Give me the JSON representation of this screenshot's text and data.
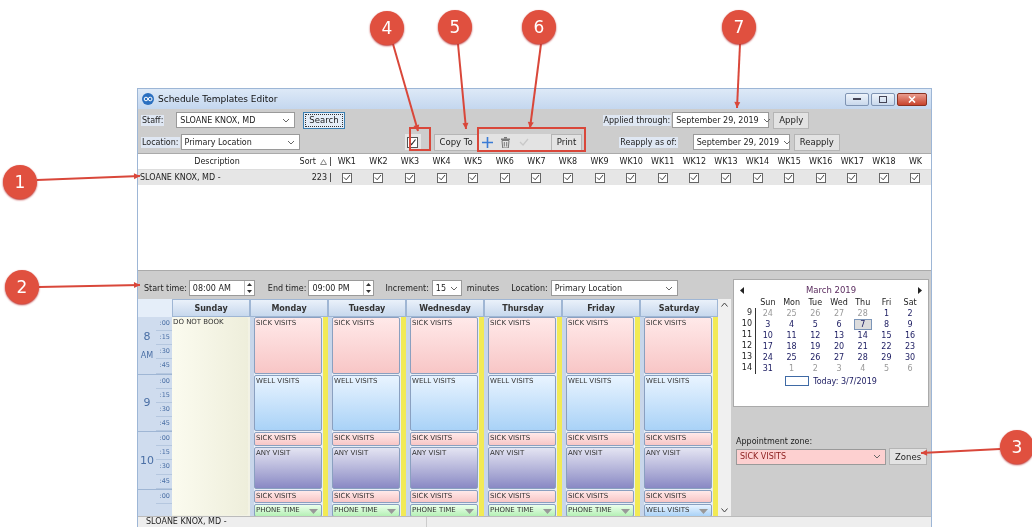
{
  "window": {
    "title": "Schedule Templates Editor"
  },
  "toolbar": {
    "staff_label": "Staff:",
    "staff": "SLOANE KNOX, MD",
    "search_button": "Search",
    "location_label": "Location:",
    "location": "Primary Location",
    "checkbox_checked": true,
    "copy_to_button": "Copy To",
    "tools": [
      {
        "kind": "add",
        "disabled": false
      },
      {
        "kind": "delete",
        "disabled": false
      },
      {
        "kind": "confirm",
        "disabled": true
      }
    ],
    "print_button": "Print",
    "applied_label": "Applied through:",
    "applied_date": "September 29, 2019",
    "apply_button": "Apply",
    "reapply_label": "Reapply as of:",
    "reapply_date": "September 29, 2019",
    "reapply_button": "Reapply"
  },
  "template_table": {
    "columns": [
      "Description",
      "Sort",
      "WK1",
      "WK2",
      "WK3",
      "WK4",
      "WK5",
      "WK6",
      "WK7",
      "WK8",
      "WK9",
      "WK10",
      "WK11",
      "WK12",
      "WK13",
      "WK14",
      "WK15",
      "WK16",
      "WK17",
      "WK18",
      "WK"
    ],
    "rows": [
      {
        "description": "SLOANE KNOX, MD -",
        "sort": "223",
        "selected": true,
        "weeks": [
          true,
          true,
          true,
          true,
          true,
          true,
          true,
          true,
          true,
          true,
          true,
          true,
          true,
          true,
          true,
          true,
          true,
          true,
          true
        ]
      }
    ]
  },
  "time_settings": {
    "start_label": "Start time:",
    "start": "08:00 AM",
    "end_label": "End time:",
    "end": "09:00 PM",
    "increment_label": "Increment:",
    "increment": "15",
    "unit": "minutes",
    "location_label": "Location:",
    "location": "Primary Location"
  },
  "schedule": {
    "hours": [
      {
        "hour": "8",
        "period": "AM",
        "minutes": [
          ":00",
          ":15",
          ":30",
          ":45"
        ]
      },
      {
        "hour": "9",
        "minutes": [
          ":00",
          ":15",
          ":30",
          ":45"
        ]
      },
      {
        "hour": "10",
        "minutes": [
          ":00",
          ":15",
          ":30",
          ":45"
        ]
      },
      {
        "minutes": [
          ":00"
        ]
      }
    ],
    "days": [
      {
        "name": "Sunday",
        "slots": [
          {
            "label": "DO NOT BOOK",
            "kind": "blocked"
          },
          {
            "continues": true
          },
          {
            "continues": true
          },
          {
            "continues": true
          },
          {
            "continues": true
          },
          {
            "continues": true
          },
          {
            "continues": true
          },
          {
            "continues": true
          },
          {
            "continues": true
          },
          {
            "continues": true
          },
          {
            "continues": true
          },
          {
            "continues": true
          },
          {
            "continues": true
          },
          {
            "continues": true
          }
        ]
      },
      {
        "name": "Monday",
        "slots": [
          {
            "label": "SICK VISITS",
            "kind": "sick"
          },
          {
            "continues": true
          },
          {
            "continues": true
          },
          {
            "continues": true
          },
          {
            "label": "WELL VISITS",
            "kind": "well"
          },
          {
            "continues": true
          },
          {
            "continues": true
          },
          {
            "continues": true
          },
          {
            "label": "SICK VISITS",
            "kind": "sick"
          },
          {
            "label": "ANY VISIT",
            "kind": "any"
          },
          {
            "continues": true
          },
          {
            "continues": true
          },
          {
            "label": "SICK VISITS",
            "kind": "sick"
          },
          {
            "label": "PHONE TIME",
            "kind": "phone",
            "dropdown": true
          }
        ]
      },
      {
        "name": "Tuesday",
        "slots": [
          {
            "label": "SICK VISITS",
            "kind": "sick"
          },
          {
            "continues": true
          },
          {
            "continues": true
          },
          {
            "continues": true
          },
          {
            "label": "WELL VISITS",
            "kind": "well"
          },
          {
            "continues": true
          },
          {
            "continues": true
          },
          {
            "continues": true
          },
          {
            "label": "SICK VISITS",
            "kind": "sick"
          },
          {
            "label": "ANY VISIT",
            "kind": "any"
          },
          {
            "continues": true
          },
          {
            "continues": true
          },
          {
            "label": "SICK VISITS",
            "kind": "sick"
          },
          {
            "label": "PHONE TIME",
            "kind": "phone",
            "dropdown": true
          }
        ]
      },
      {
        "name": "Wednesday",
        "slots": [
          {
            "label": "SICK VISITS",
            "kind": "sick"
          },
          {
            "continues": true
          },
          {
            "continues": true
          },
          {
            "continues": true
          },
          {
            "label": "WELL VISITS",
            "kind": "well"
          },
          {
            "continues": true
          },
          {
            "continues": true
          },
          {
            "continues": true
          },
          {
            "label": "SICK VISITS",
            "kind": "sick"
          },
          {
            "label": "ANY VISIT",
            "kind": "any"
          },
          {
            "continues": true
          },
          {
            "continues": true
          },
          {
            "label": "SICK VISITS",
            "kind": "sick"
          },
          {
            "label": "PHONE TIME",
            "kind": "phone",
            "dropdown": true
          }
        ]
      },
      {
        "name": "Thursday",
        "slots": [
          {
            "label": "SICK VISITS",
            "kind": "sick"
          },
          {
            "continues": true
          },
          {
            "continues": true
          },
          {
            "continues": true
          },
          {
            "label": "WELL VISITS",
            "kind": "well"
          },
          {
            "continues": true
          },
          {
            "continues": true
          },
          {
            "continues": true
          },
          {
            "label": "SICK VISITS",
            "kind": "sick"
          },
          {
            "label": "ANY VISIT",
            "kind": "any"
          },
          {
            "continues": true
          },
          {
            "continues": true
          },
          {
            "label": "SICK VISITS",
            "kind": "sick"
          },
          {
            "label": "PHONE TIME",
            "kind": "phone",
            "dropdown": true
          }
        ]
      },
      {
        "name": "Friday",
        "slots": [
          {
            "label": "SICK VISITS",
            "kind": "sick"
          },
          {
            "continues": true
          },
          {
            "continues": true
          },
          {
            "continues": true
          },
          {
            "label": "WELL VISITS",
            "kind": "well"
          },
          {
            "continues": true
          },
          {
            "continues": true
          },
          {
            "continues": true
          },
          {
            "label": "SICK VISITS",
            "kind": "sick"
          },
          {
            "label": "ANY VISIT",
            "kind": "any"
          },
          {
            "continues": true
          },
          {
            "continues": true
          },
          {
            "label": "SICK VISITS",
            "kind": "sick"
          },
          {
            "label": "PHONE TIME",
            "kind": "phone",
            "dropdown": true
          }
        ]
      },
      {
        "name": "Saturday",
        "slots": [
          {
            "label": "SICK VISITS",
            "kind": "sick"
          },
          {
            "continues": true
          },
          {
            "continues": true
          },
          {
            "continues": true
          },
          {
            "label": "WELL VISITS",
            "kind": "well"
          },
          {
            "continues": true
          },
          {
            "continues": true
          },
          {
            "continues": true
          },
          {
            "label": "SICK VISITS",
            "kind": "sick"
          },
          {
            "label": "ANY VISIT",
            "kind": "any"
          },
          {
            "continues": true
          },
          {
            "continues": true
          },
          {
            "label": "SICK VISITS",
            "kind": "sick"
          },
          {
            "label": "WELL VISITS",
            "kind": "well",
            "dropdown": true
          }
        ]
      }
    ]
  },
  "calendar": {
    "month": "March 2019",
    "weekdays": [
      "Sun",
      "Mon",
      "Tue",
      "Wed",
      "Thu",
      "Fri",
      "Sat"
    ],
    "weeks": [
      {
        "number": "9",
        "days": [
          {
            "day": "24",
            "other_month": true,
            "selected": false
          },
          {
            "day": "25",
            "other_month": true,
            "selected": false
          },
          {
            "day": "26",
            "other_month": true,
            "selected": false
          },
          {
            "day": "27",
            "other_month": true,
            "selected": false
          },
          {
            "day": "28",
            "other_month": true,
            "selected": false
          },
          {
            "day": "1",
            "other_month": false,
            "selected": false
          },
          {
            "day": "2",
            "other_month": false,
            "selected": false
          }
        ]
      },
      {
        "number": "10",
        "days": [
          {
            "day": "3",
            "other_month": false,
            "selected": false
          },
          {
            "day": "4",
            "other_month": false,
            "selected": false
          },
          {
            "day": "5",
            "other_month": false,
            "selected": false
          },
          {
            "day": "6",
            "other_month": false,
            "selected": false
          },
          {
            "day": "7",
            "other_month": false,
            "selected": true
          },
          {
            "day": "8",
            "other_month": false,
            "selected": false
          },
          {
            "day": "9",
            "other_month": false,
            "selected": false
          }
        ]
      },
      {
        "number": "11",
        "days": [
          {
            "day": "10",
            "other_month": false,
            "selected": false
          },
          {
            "day": "11",
            "other_month": false,
            "selected": false
          },
          {
            "day": "12",
            "other_month": false,
            "selected": false
          },
          {
            "day": "13",
            "other_month": false,
            "selected": false
          },
          {
            "day": "14",
            "other_month": false,
            "selected": false
          },
          {
            "day": "15",
            "other_month": false,
            "selected": false
          },
          {
            "day": "16",
            "other_month": false,
            "selected": false
          }
        ]
      },
      {
        "number": "12",
        "days": [
          {
            "day": "17",
            "other_month": false,
            "selected": false
          },
          {
            "day": "18",
            "other_month": false,
            "selected": false
          },
          {
            "day": "19",
            "other_month": false,
            "selected": false
          },
          {
            "day": "20",
            "other_month": false,
            "selected": false
          },
          {
            "day": "21",
            "other_month": false,
            "selected": false
          },
          {
            "day": "22",
            "other_month": false,
            "selected": false
          },
          {
            "day": "23",
            "other_month": false,
            "selected": false
          }
        ]
      },
      {
        "number": "13",
        "days": [
          {
            "day": "24",
            "other_month": false,
            "selected": false
          },
          {
            "day": "25",
            "other_month": false,
            "selected": false
          },
          {
            "day": "26",
            "other_month": false,
            "selected": false
          },
          {
            "day": "27",
            "other_month": false,
            "selected": false
          },
          {
            "day": "28",
            "other_month": false,
            "selected": false
          },
          {
            "day": "29",
            "other_month": false,
            "selected": false
          },
          {
            "day": "30",
            "other_month": false,
            "selected": false
          }
        ]
      },
      {
        "number": "14",
        "days": [
          {
            "day": "31",
            "other_month": false,
            "selected": false
          },
          {
            "day": "1",
            "other_month": true,
            "selected": false
          },
          {
            "day": "2",
            "other_month": true,
            "selected": false
          },
          {
            "day": "3",
            "other_month": true,
            "selected": false
          },
          {
            "day": "4",
            "other_month": true,
            "selected": false
          },
          {
            "day": "5",
            "other_month": true,
            "selected": false
          },
          {
            "day": "6",
            "other_month": true,
            "selected": false
          }
        ]
      }
    ],
    "today": "Today: 3/7/2019"
  },
  "zone": {
    "label": "Appointment zone:",
    "value": "SICK VISITS",
    "button": "Zones"
  },
  "status_bar": {
    "text": "SLOANE KNOX, MD -"
  },
  "annotations": [
    {
      "number": "1"
    },
    {
      "number": "2"
    },
    {
      "number": "3"
    },
    {
      "number": "4"
    },
    {
      "number": "5"
    },
    {
      "number": "6"
    },
    {
      "number": "7"
    }
  ]
}
